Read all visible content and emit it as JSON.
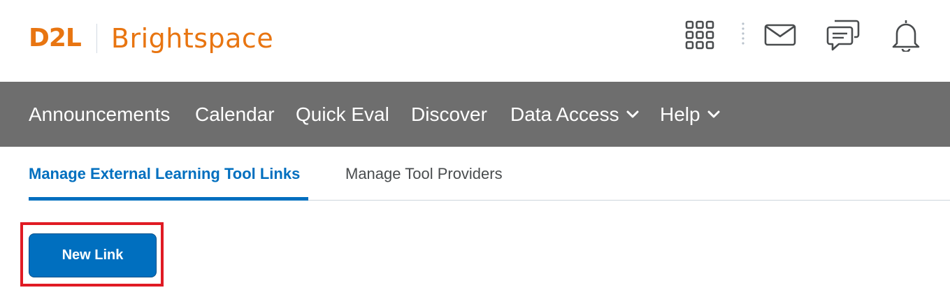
{
  "brand": {
    "logo_mark": "D2L",
    "product_name": "Brightspace",
    "color": "#e87511"
  },
  "header_icons": [
    {
      "name": "waffle-grid-icon",
      "label": ""
    },
    {
      "name": "mail-icon",
      "label": ""
    },
    {
      "name": "chat-icon",
      "label": ""
    },
    {
      "name": "bell-icon",
      "label": ""
    }
  ],
  "nav": {
    "background": "#6e6e6e",
    "items": [
      {
        "label": "Announcements",
        "has_dropdown": false
      },
      {
        "label": "Calendar",
        "has_dropdown": false
      },
      {
        "label": "Quick Eval",
        "has_dropdown": false
      },
      {
        "label": "Discover",
        "has_dropdown": false
      },
      {
        "label": "Data Access",
        "has_dropdown": true
      },
      {
        "label": "Help",
        "has_dropdown": true
      }
    ]
  },
  "tabs": [
    {
      "label": "Manage External Learning Tool Links",
      "active": true
    },
    {
      "label": "Manage Tool Providers",
      "active": false
    }
  ],
  "actions": {
    "new_link_label": "New Link"
  },
  "colors": {
    "accent": "#006fbf",
    "highlight": "#e01b24"
  }
}
